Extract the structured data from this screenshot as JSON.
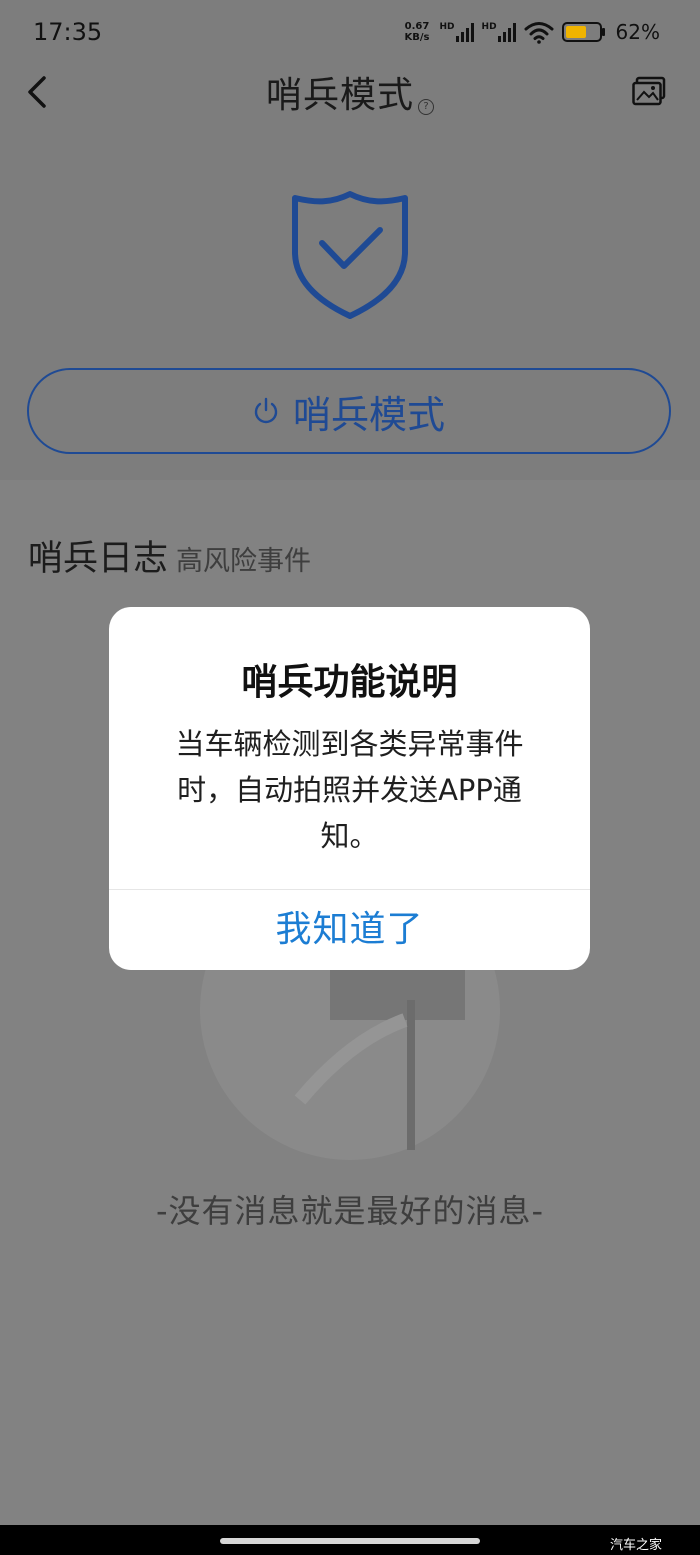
{
  "status_bar": {
    "time": "17:35",
    "net_speed_value": "0.67",
    "net_speed_unit": "KB/s",
    "sim1_badge": "HD",
    "sim2_badge": "HD",
    "battery_percent": "62%",
    "battery_level": 0.62,
    "battery_color": "#f0b400"
  },
  "nav": {
    "title": "哨兵模式",
    "help_glyph": "?"
  },
  "sentry_button": {
    "label": "哨兵模式"
  },
  "log": {
    "title": "哨兵日志",
    "filter": "高风险事件"
  },
  "empty_state": {
    "message": "-没有消息就是最好的消息-"
  },
  "dialog": {
    "title": "哨兵功能说明",
    "body": "当车辆检测到各类异常事件时，自动拍照并发送APP通知。",
    "confirm": "我知道了"
  },
  "watermark": "汽车之家",
  "colors": {
    "accent_blue": "#1f4a94",
    "dialog_button": "#1c7dd3",
    "overlay": "#7d7d7d"
  },
  "icons": {
    "back": "chevron-left-icon",
    "gallery": "gallery-icon",
    "shield": "shield-check-icon",
    "power": "power-icon",
    "wifi": "wifi-icon",
    "signal": "signal-icon",
    "battery": "battery-icon"
  }
}
